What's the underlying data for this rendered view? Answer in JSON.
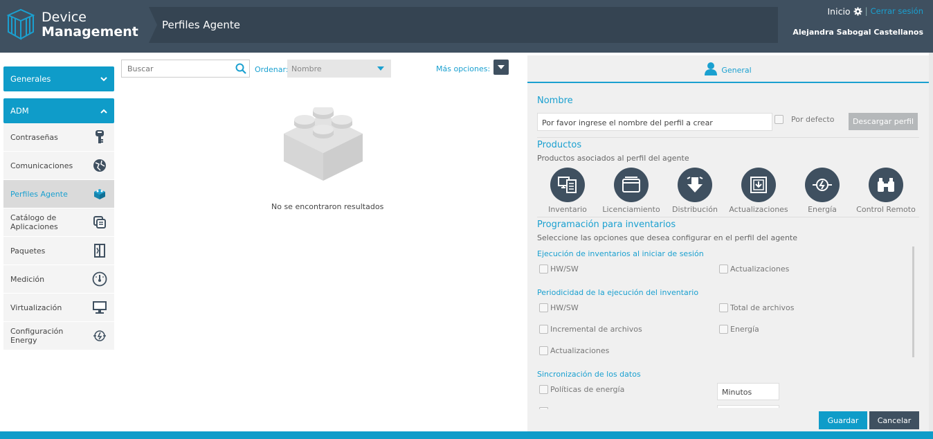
{
  "app": {
    "title_line1": "Device",
    "title_line2": "Management",
    "page_title": "Perfiles Agente"
  },
  "top_right": {
    "home": "Inicio",
    "separator": "|",
    "logout": "Cerrar sesión",
    "user": "Alejandra Sabogal Castellanos"
  },
  "sidebar": {
    "generales": "Generales",
    "adm": "ADM",
    "items": [
      {
        "label": "Contraseñas",
        "icon": "key-icon"
      },
      {
        "label": "Comunicaciones",
        "icon": "globe-icon"
      },
      {
        "label": "Perfiles Agente",
        "icon": "cube-icon"
      },
      {
        "label": "Catálogo de Aplicaciones",
        "icon": "apps-icon"
      },
      {
        "label": "Paquetes",
        "icon": "package-icon"
      },
      {
        "label": "Medición",
        "icon": "gauge-icon"
      },
      {
        "label": "Virtualización",
        "icon": "monitor-icon"
      },
      {
        "label": "Configuración Energy",
        "icon": "energy-icon"
      }
    ]
  },
  "list": {
    "search_placeholder": "Buscar",
    "order_label": "Ordenar:",
    "order_value": "Nombre",
    "more_options": "Más opciones:",
    "empty_text": "No se encontraron resultados"
  },
  "panel": {
    "tab": "General",
    "name_title": "Nombre",
    "name_placeholder": "Por favor ingrese el nombre del perfil a crear",
    "default_label": "Por defecto",
    "download_button": "Descargar perfil",
    "products_title": "Productos",
    "products_sub": "Productos asociados al perfil del agente",
    "products": [
      "Inventario",
      "Licenciamiento",
      "Distribución",
      "Actualizaciones",
      "Energía",
      "Control Remoto"
    ],
    "schedule_title": "Programación para inventarios",
    "schedule_sub": "Seleccione las opciones que desea configurar en el perfil del agente",
    "login_title": "Ejecución de inventarios al iniciar de sesión",
    "login_opts": [
      "HW/SW",
      "Actualizaciones"
    ],
    "period_title": "Periodicidad de la ejecución del inventario",
    "period_opts": [
      "HW/SW",
      "Total de archivos",
      "Incremental de archivos",
      "Energía",
      "Actualizaciones"
    ],
    "sync_title": "Sincronización de los datos",
    "sync_opt": "Políticas de energía",
    "minutes_placeholder": "Minutos",
    "save": "Guardar",
    "cancel": "Cancelar"
  },
  "colors": {
    "header": "#3f5060",
    "accent": "#0f9cc9",
    "link": "#1aa0d0"
  }
}
